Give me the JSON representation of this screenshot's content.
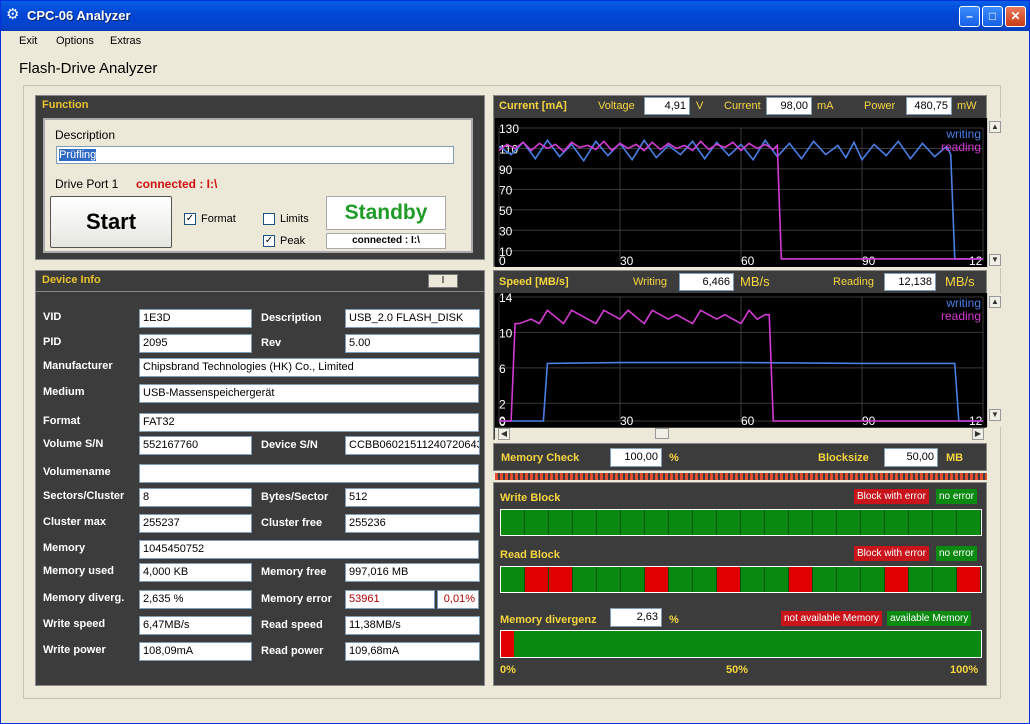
{
  "window": {
    "title": "CPC-06 Analyzer"
  },
  "menu": [
    "Exit",
    "Options",
    "Extras"
  ],
  "app_title": "Flash-Drive Analyzer",
  "function": {
    "header": "Function",
    "description_label": "Description",
    "description_value": "Prüfling",
    "drive_port_label": "Drive Port 1",
    "connected_text": "connected : I:\\",
    "start_label": "Start",
    "format_label": "Format",
    "limits_label": "Limits",
    "peak_label": "Peak",
    "format_checked": true,
    "limits_checked": false,
    "peak_checked": true,
    "status": "Standby",
    "status_connected": "connected : I:\\"
  },
  "device": {
    "header": "Device Info",
    "toggle_label": "I",
    "rows": [
      {
        "l1": "VID",
        "v1": "1E3D",
        "l2": "Description",
        "v2": "USB_2.0 FLASH_DISK"
      },
      {
        "l1": "PID",
        "v1": "2095",
        "l2": "Rev",
        "v2": "5.00"
      },
      {
        "l1": "Manufacturer",
        "v1": "Chipsbrand Technologies (HK) Co., Limited"
      },
      {
        "l1": "Medium",
        "v1": "USB-Massenspeichergerät"
      },
      {
        "l1": "Format",
        "v1": "FAT32"
      },
      {
        "l1": "Volume S/N",
        "v1": "552167760",
        "l2": "Device S/N",
        "v2": "CCBB06021511240720643"
      },
      {
        "l1": "Volumename",
        "v1": ""
      },
      {
        "l1": "Sectors/Cluster",
        "v1": "8",
        "l2": "Bytes/Sector",
        "v2": "512"
      },
      {
        "l1": "Cluster max",
        "v1": "255237",
        "l2": "Cluster free",
        "v2": "255236"
      },
      {
        "l1": "Memory",
        "v1": "1045450752"
      },
      {
        "l1": "Memory used",
        "v1": "4,000 KB",
        "l2": "Memory free",
        "v2": "997,016 MB"
      },
      {
        "l1": "Memory diverg.",
        "v1": "2,635 %",
        "l2": "Memory error",
        "v2": "53961",
        "v3": "0,01%"
      },
      {
        "l1": "Write speed",
        "v1": "6,47MB/s",
        "l2": "Read speed",
        "v2": "11,38MB/s"
      },
      {
        "l1": "Write power",
        "v1": "108,09mA",
        "l2": "Read power",
        "v2": "109,68mA"
      }
    ]
  },
  "current": {
    "header": "Current [mA]",
    "voltage_label": "Voltage",
    "voltage": "4,91",
    "voltage_unit": "V",
    "current_label": "Current",
    "current": "98,00",
    "current_unit": "mA",
    "power_label": "Power",
    "power": "480,75",
    "power_unit": "mW"
  },
  "speed": {
    "header": "Speed [MB/s]",
    "writing_label": "Writing",
    "writing": "6,466",
    "writing_unit": "MB/s",
    "reading_label": "Reading",
    "reading": "12,138",
    "reading_unit": "MB/s"
  },
  "chart_data": [
    {
      "type": "line",
      "title": "Current [mA]",
      "y_ticks": [
        "130",
        "110",
        "90",
        "70",
        "50",
        "30",
        "10"
      ],
      "x_ticks": [
        "0",
        "30",
        "60",
        "90",
        "12"
      ],
      "ylim": [
        0,
        130
      ],
      "xlim": [
        0,
        120
      ],
      "series": [
        {
          "name": "writing",
          "color": "#4a7fe6",
          "x": [
            0,
            3,
            6,
            9,
            12,
            15,
            18,
            21,
            24,
            27,
            30,
            33,
            36,
            39,
            42,
            45,
            48,
            51,
            54,
            57,
            60,
            63,
            66,
            69,
            72,
            75,
            78,
            81,
            84,
            86,
            88,
            90,
            93,
            96,
            99,
            102,
            105,
            108,
            111,
            112,
            113,
            120
          ],
          "y": [
            112,
            104,
            116,
            100,
            118,
            102,
            114,
            98,
            117,
            103,
            115,
            99,
            118,
            101,
            113,
            104,
            117,
            100,
            116,
            103,
            114,
            99,
            118,
            102,
            115,
            100,
            117,
            104,
            113,
            101,
            116,
            99,
            114,
            103,
            117,
            100,
            115,
            102,
            112,
            104,
            2,
            2
          ]
        },
        {
          "name": "reading",
          "color": "#d43bd4",
          "x": [
            0,
            2,
            4,
            6,
            8,
            10,
            12,
            14,
            16,
            18,
            20,
            22,
            24,
            26,
            28,
            30,
            32,
            34,
            36,
            38,
            40,
            42,
            44,
            46,
            48,
            50,
            52,
            54,
            56,
            58,
            60,
            62,
            64,
            66,
            68,
            69,
            70,
            120
          ],
          "y": [
            108,
            114,
            110,
            116,
            108,
            115,
            110,
            114,
            107,
            116,
            111,
            113,
            109,
            117,
            108,
            115,
            110,
            114,
            108,
            116,
            109,
            115,
            110,
            113,
            108,
            117,
            109,
            114,
            111,
            116,
            108,
            115,
            110,
            114,
            109,
            113,
            2,
            2
          ]
        }
      ]
    },
    {
      "type": "line",
      "title": "Speed [MB/s]",
      "y_ticks": [
        "14",
        "10",
        "6",
        "2",
        "0"
      ],
      "x_ticks": [
        "0",
        "30",
        "60",
        "90",
        "12"
      ],
      "ylim": [
        0,
        14
      ],
      "xlim": [
        0,
        120
      ],
      "series": [
        {
          "name": "writing",
          "color": "#4a7fe6",
          "x": [
            0,
            10,
            11,
            12,
            30,
            60,
            90,
            113,
            114,
            120
          ],
          "y": [
            0,
            0,
            0,
            6.5,
            6.6,
            6.6,
            6.5,
            6.5,
            0,
            0
          ]
        },
        {
          "name": "reading",
          "color": "#d43bd4",
          "x": [
            0,
            3,
            4,
            5,
            8,
            10,
            12,
            16,
            18,
            20,
            24,
            26,
            30,
            32,
            36,
            38,
            42,
            44,
            48,
            50,
            54,
            56,
            60,
            62,
            64,
            66,
            67,
            68,
            120
          ],
          "y": [
            0,
            0,
            11,
            11,
            11.5,
            11,
            12.5,
            11,
            12.5,
            12,
            11,
            12.5,
            11.5,
            12.5,
            11,
            12.5,
            11.5,
            12,
            11,
            12.5,
            11.5,
            12,
            11,
            12.5,
            11.5,
            12,
            12,
            0,
            0
          ]
        }
      ]
    }
  ],
  "memcheck": {
    "label": "Memory Check",
    "value": "100,00",
    "unit": "%",
    "blocksize_label": "Blocksize",
    "blocksize": "50,00",
    "blocksize_unit": "MB"
  },
  "write_block": {
    "label": "Write Block",
    "legend_error": "Block with error",
    "legend_ok": "no error",
    "cells": [
      "ok",
      "ok",
      "ok",
      "ok",
      "ok",
      "ok",
      "ok",
      "ok",
      "ok",
      "ok",
      "ok",
      "ok",
      "ok",
      "ok",
      "ok",
      "ok",
      "ok",
      "ok",
      "ok",
      "ok"
    ]
  },
  "read_block": {
    "label": "Read Block",
    "legend_error": "Block with error",
    "legend_ok": "no error",
    "cells": [
      "ok",
      "err",
      "err",
      "ok",
      "ok",
      "ok",
      "err",
      "ok",
      "ok",
      "err",
      "ok",
      "ok",
      "err",
      "ok",
      "ok",
      "ok",
      "err",
      "ok",
      "ok",
      "err"
    ]
  },
  "divergenz": {
    "label": "Memory divergenz",
    "value": "2,63",
    "unit": "%",
    "legend_na": "not available Memory",
    "legend_a": "available Memory",
    "fraction": 0.0263,
    "t0": "0%",
    "t50": "50%",
    "t100": "100%"
  },
  "colors": {
    "ok": "#0a8a10",
    "err": "#e00000",
    "panel": "#3c3c3c",
    "accent": "#f5d640"
  }
}
